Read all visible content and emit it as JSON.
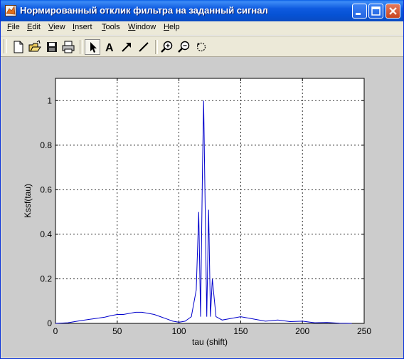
{
  "window": {
    "title": "Нормированный отклик фильтра на заданный сигнал",
    "buttons": [
      "minimize",
      "maximize",
      "close"
    ]
  },
  "menu": {
    "items": [
      {
        "label": "File",
        "underline": "F",
        "rest": "ile"
      },
      {
        "label": "Edit",
        "underline": "E",
        "rest": "dit"
      },
      {
        "label": "View",
        "underline": "V",
        "rest": "iew"
      },
      {
        "label": "Insert",
        "underline": "I",
        "rest": "nsert"
      },
      {
        "label": "Tools",
        "underline": "T",
        "rest": "ools"
      },
      {
        "label": "Window",
        "underline": "W",
        "rest": "indow"
      },
      {
        "label": "Help",
        "underline": "H",
        "rest": "elp"
      }
    ]
  },
  "toolbar": {
    "tools": [
      "new-file-icon",
      "open-folder-icon",
      "save-icon",
      "print-icon",
      "select-arrow-icon",
      "insert-text-icon",
      "insert-arrow-icon",
      "insert-line-icon",
      "zoom-in-icon",
      "zoom-out-icon",
      "rotate-3d-icon"
    ],
    "active_tool": "select-arrow-icon"
  },
  "chart_data": {
    "type": "line",
    "title": "",
    "xlabel": "tau (shift)",
    "ylabel": "Kssf(tau)",
    "xlim": [
      0,
      250
    ],
    "ylim": [
      0,
      1.1
    ],
    "xticks": [
      0,
      50,
      100,
      150,
      200,
      250
    ],
    "yticks": [
      0,
      0.2,
      0.4,
      0.6,
      0.8,
      1
    ],
    "grid": true,
    "series": [
      {
        "color": "#0000cc",
        "x": [
          0,
          10,
          20,
          30,
          40,
          45,
          50,
          55,
          60,
          65,
          70,
          75,
          80,
          85,
          90,
          95,
          100,
          105,
          110,
          114,
          116,
          117.5,
          119,
          120,
          121,
          122.5,
          124,
          125.5,
          127,
          130,
          135,
          140,
          150,
          160,
          170,
          180,
          190,
          200,
          210,
          220,
          230,
          240
        ],
        "y": [
          0,
          0.003,
          0.012,
          0.02,
          0.028,
          0.035,
          0.04,
          0.04,
          0.045,
          0.05,
          0.05,
          0.045,
          0.04,
          0.03,
          0.02,
          0.01,
          0.005,
          0.01,
          0.03,
          0.15,
          0.5,
          0.03,
          0.68,
          1.0,
          0.6,
          0.03,
          0.51,
          0.03,
          0.2,
          0.03,
          0.015,
          0.02,
          0.03,
          0.02,
          0.01,
          0.015,
          0.008,
          0.01,
          0.003,
          0.004,
          0.001,
          0
        ]
      }
    ]
  }
}
